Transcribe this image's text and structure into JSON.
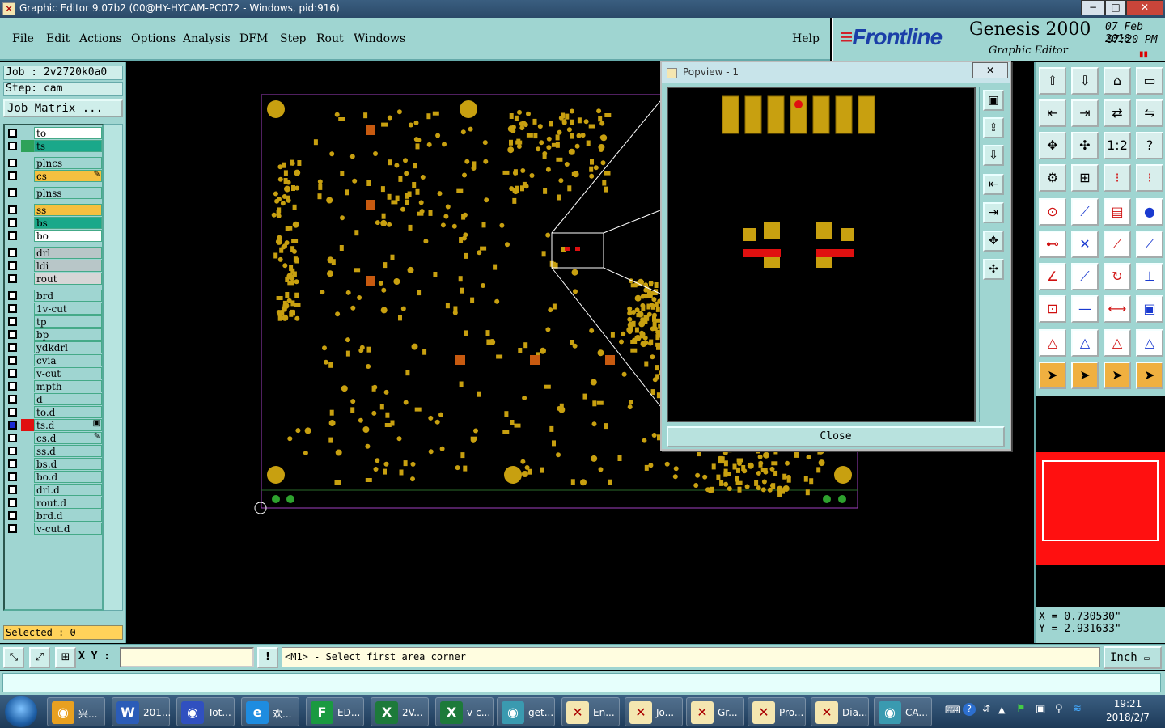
{
  "window": {
    "title": "Graphic Editor 9.07b2 (00@HY-HYCAM-PC072 - Windows, pid:916)",
    "minimize": "−",
    "maximize": "□",
    "close": "✕"
  },
  "menu": {
    "items": [
      "File",
      "Edit",
      "Actions",
      "Options",
      "Analysis",
      "DFM",
      "Step",
      "Rout",
      "Windows"
    ],
    "help": "Help"
  },
  "brand": {
    "logo": "Frontline",
    "product": "Genesis 2000",
    "subtitle": "Graphic Editor",
    "date": "07 Feb 2018",
    "time": "07:20 PM",
    "logo_color": "#1b3fa8",
    "accent": "#d0202a"
  },
  "job": {
    "job_label": "Job : 2v2720k0a0",
    "step_label": "Step: cam",
    "matrix_button": "Job Matrix ..."
  },
  "layers": [
    {
      "name": "to",
      "color": "#ffffff",
      "swatch": ""
    },
    {
      "name": "ts",
      "color": "#1aa88a",
      "swatch": "#2ea25a"
    },
    {
      "name": "plncs",
      "color": "#9fd5d1",
      "swatch": ""
    },
    {
      "name": "cs",
      "color": "#f5c040",
      "swatch": "",
      "mark": "✎"
    },
    {
      "name": "plnss",
      "color": "#9fd5d1",
      "swatch": ""
    },
    {
      "name": "ss",
      "color": "#f5c040",
      "swatch": ""
    },
    {
      "name": "bs",
      "color": "#1aa88a",
      "swatch": ""
    },
    {
      "name": "bo",
      "color": "#ffffff",
      "swatch": ""
    },
    {
      "name": "drl",
      "color": "#b8c6c8",
      "swatch": ""
    },
    {
      "name": "ldi",
      "color": "#b8c6c8",
      "swatch": ""
    },
    {
      "name": "rout",
      "color": "#d6d6d6",
      "swatch": ""
    },
    {
      "name": "brd",
      "color": "#9fd5d1",
      "swatch": ""
    },
    {
      "name": "1v-cut",
      "color": "#9fd5d1",
      "swatch": ""
    },
    {
      "name": "tp",
      "color": "#9fd5d1",
      "swatch": ""
    },
    {
      "name": "bp",
      "color": "#9fd5d1",
      "swatch": ""
    },
    {
      "name": "ydkdrl",
      "color": "#9fd5d1",
      "swatch": ""
    },
    {
      "name": "cvia",
      "color": "#9fd5d1",
      "swatch": ""
    },
    {
      "name": "v-cut",
      "color": "#9fd5d1",
      "swatch": ""
    },
    {
      "name": "mpth",
      "color": "#9fd5d1",
      "swatch": ""
    },
    {
      "name": "d",
      "color": "#9fd5d1",
      "swatch": ""
    },
    {
      "name": "to.d",
      "color": "#9fd5d1",
      "swatch": ""
    },
    {
      "name": "ts.d",
      "color": "#9fd5d1",
      "swatch": "#e01010",
      "active": true,
      "mark": "▣"
    },
    {
      "name": "cs.d",
      "color": "#9fd5d1",
      "swatch": "",
      "mark": "✎"
    },
    {
      "name": "ss.d",
      "color": "#9fd5d1",
      "swatch": ""
    },
    {
      "name": "bs.d",
      "color": "#9fd5d1",
      "swatch": ""
    },
    {
      "name": "bo.d",
      "color": "#9fd5d1",
      "swatch": ""
    },
    {
      "name": "drl.d",
      "color": "#9fd5d1",
      "swatch": ""
    },
    {
      "name": "rout.d",
      "color": "#9fd5d1",
      "swatch": ""
    },
    {
      "name": "brd.d",
      "color": "#9fd5d1",
      "swatch": ""
    },
    {
      "name": "v-cut.d",
      "color": "#9fd5d1",
      "swatch": ""
    }
  ],
  "selected": "Selected : 0",
  "popview": {
    "title": "Popview - 1",
    "close_label": "Close",
    "x_label": "✕"
  },
  "coords": {
    "x": "X = 0.730530\"",
    "y": "Y = 2.931633\""
  },
  "command": {
    "xy_label": "X Y :",
    "xy_value": "",
    "warn_icon": "!",
    "prompt": "<M1> - Select first area corner",
    "unit": "Inch"
  },
  "taskbar": {
    "tasks": [
      {
        "label": "兴...",
        "icon": "shell-icon",
        "color": "#e8a020"
      },
      {
        "label": "201...",
        "icon": "word-icon",
        "color": "#2b5cb8"
      },
      {
        "label": "Tot...",
        "icon": "floppy-icon",
        "color": "#3050c0"
      },
      {
        "label": "欢...",
        "icon": "ie-icon",
        "color": "#1e8ce0"
      },
      {
        "label": "ED...",
        "icon": "frontline-f-icon",
        "color": "#1a9a40"
      },
      {
        "label": "2V...",
        "icon": "excel-icon",
        "color": "#1d7a3a"
      },
      {
        "label": "v-c...",
        "icon": "excel-icon",
        "color": "#1d7a3a"
      },
      {
        "label": "get...",
        "icon": "genesis-icon",
        "color": "#3a9ab0"
      },
      {
        "label": "En...",
        "icon": "genesis-x-icon",
        "color": "#f4e6b0"
      },
      {
        "label": "Jo...",
        "icon": "genesis-x-icon",
        "color": "#f4e6b0"
      },
      {
        "label": "Gr...",
        "icon": "genesis-x-icon",
        "color": "#f4e6b0"
      },
      {
        "label": "Pro...",
        "icon": "genesis-x-icon",
        "color": "#f4e6b0"
      },
      {
        "label": "Dia...",
        "icon": "genesis-x-icon",
        "color": "#f4e6b0"
      },
      {
        "label": "CA...",
        "icon": "genesis-icon",
        "color": "#3a9ab0"
      }
    ],
    "clock_time": "19:21",
    "clock_date": "2018/2/7"
  },
  "colors": {
    "panel": "#9fd5d1",
    "pad": "#c8a010",
    "highlight": "#e01010",
    "board_outline": "#a040c0"
  }
}
